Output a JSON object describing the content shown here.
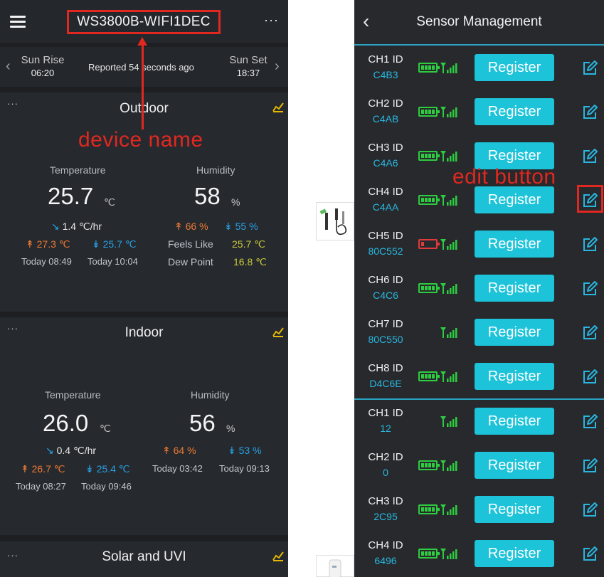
{
  "dashboard": {
    "device_name": "WS3800B-WIFI1DEC",
    "more": "···",
    "sunrise_label": "Sun Rise",
    "sunrise_time": "06:20",
    "reported": "Reported 54 seconds ago",
    "sunset_label": "Sun Set",
    "sunset_time": "18:37",
    "annotation": "device name",
    "outdoor": {
      "title": "Outdoor",
      "temp_label": "Temperature",
      "temp": "25.7",
      "temp_unit": "℃",
      "trend": "1.4 ℃/hr",
      "temp_high": "27.3 ℃",
      "temp_low": "25.7 ℃",
      "temp_high_time": "Today 08:49",
      "temp_low_time": "Today 10:04",
      "hum_label": "Humidity",
      "hum": "58",
      "hum_unit": "%",
      "hum_high": "66 %",
      "hum_low": "55 %",
      "feels_label": "Feels Like",
      "feels": "25.7 ℃",
      "dew_label": "Dew Point",
      "dew": "16.8 ℃"
    },
    "indoor": {
      "title": "Indoor",
      "temp_label": "Temperature",
      "temp": "26.0",
      "temp_unit": "℃",
      "trend": "0.4 ℃/hr",
      "temp_high": "26.7 ℃",
      "temp_low": "25.4 ℃",
      "temp_high_time": "Today 08:27",
      "temp_low_time": "Today 09:46",
      "hum_label": "Humidity",
      "hum": "56",
      "hum_unit": "%",
      "hum_high": "64 %",
      "hum_low": "53 %",
      "hum_high_time": "Today 03:42",
      "hum_low_time": "Today 09:13"
    },
    "solar": {
      "title": "Solar and UVI"
    }
  },
  "sensors": {
    "title": "Sensor Management",
    "annotation": "edit button",
    "register_label": "Register",
    "rows": [
      {
        "label": "CH1 ID",
        "id": "C4B3",
        "battery": "full"
      },
      {
        "label": "CH2 ID",
        "id": "C4AB",
        "battery": "full"
      },
      {
        "label": "CH3 ID",
        "id": "C4A6",
        "battery": "full"
      },
      {
        "label": "CH4 ID",
        "id": "C4AA",
        "battery": "full"
      },
      {
        "label": "CH5 ID",
        "id": "80C552",
        "battery": "low"
      },
      {
        "label": "CH6 ID",
        "id": "C4C6",
        "battery": "full"
      },
      {
        "label": "CH7 ID",
        "id": "80C550",
        "battery": "none"
      },
      {
        "label": "CH8 ID",
        "id": "D4C6E",
        "battery": "full"
      },
      {
        "label": "CH1 ID",
        "id": "12",
        "battery": "none"
      },
      {
        "label": "CH2 ID",
        "id": "0",
        "battery": "full"
      },
      {
        "label": "CH3 ID",
        "id": "2C95",
        "battery": "full"
      },
      {
        "label": "CH4 ID",
        "id": "6496",
        "battery": "full"
      }
    ]
  },
  "colors": {
    "annotation_red": "#e02820",
    "register_cyan": "#1cc3d9",
    "battery_green": "#2ecc40",
    "battery_low_red": "#e03a3a",
    "temp_high_orange": "#f07a32",
    "low_blue": "#27a3e6"
  }
}
